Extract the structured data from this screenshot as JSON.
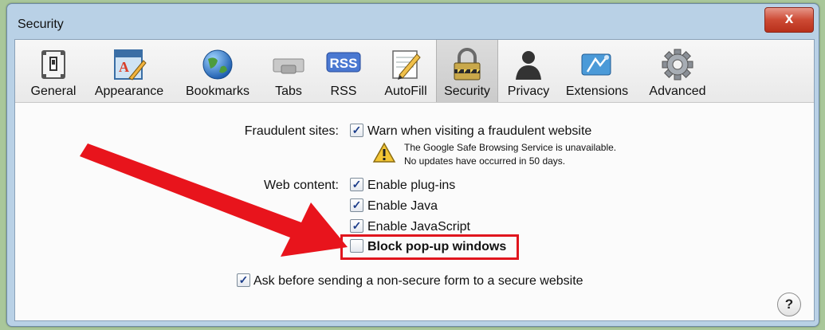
{
  "window": {
    "title": "Security",
    "close_glyph": "x"
  },
  "toolbar": {
    "tabs": [
      {
        "label": "General",
        "icon": "general-switch-icon"
      },
      {
        "label": "Appearance",
        "icon": "appearance-icon"
      },
      {
        "label": "Bookmarks",
        "icon": "bookmarks-globe-icon"
      },
      {
        "label": "Tabs",
        "icon": "tabs-icon"
      },
      {
        "label": "RSS",
        "icon": "rss-icon"
      },
      {
        "label": "AutoFill",
        "icon": "autofill-pencil-icon"
      },
      {
        "label": "Security",
        "icon": "lock-icon",
        "selected": true
      },
      {
        "label": "Privacy",
        "icon": "privacy-person-icon"
      },
      {
        "label": "Extensions",
        "icon": "extensions-icon"
      },
      {
        "label": "Advanced",
        "icon": "advanced-gear-icon"
      }
    ],
    "rss_badge": "RSS"
  },
  "fraudulent": {
    "label": "Fraudulent sites:",
    "checkbox_label": "Warn when visiting a fraudulent website",
    "checked": true,
    "warning_line1": "The Google Safe Browsing Service is unavailable.",
    "warning_line2": "No updates have occurred in 50 days."
  },
  "web_content": {
    "label": "Web content:",
    "options": [
      {
        "label": "Enable plug-ins",
        "checked": true
      },
      {
        "label": "Enable Java",
        "checked": true
      },
      {
        "label": "Enable JavaScript",
        "checked": true
      },
      {
        "label": "Block pop-up windows",
        "checked": false
      }
    ]
  },
  "nonsecure": {
    "label": "Ask before sending a non-secure form to a secure website",
    "checked": true
  },
  "help": {
    "glyph": "?"
  },
  "check_glyph": "✓",
  "colors": {
    "annotation_red": "#e0151d",
    "window_frame": "#b9d1e6",
    "close_button": "#cd4a34"
  }
}
